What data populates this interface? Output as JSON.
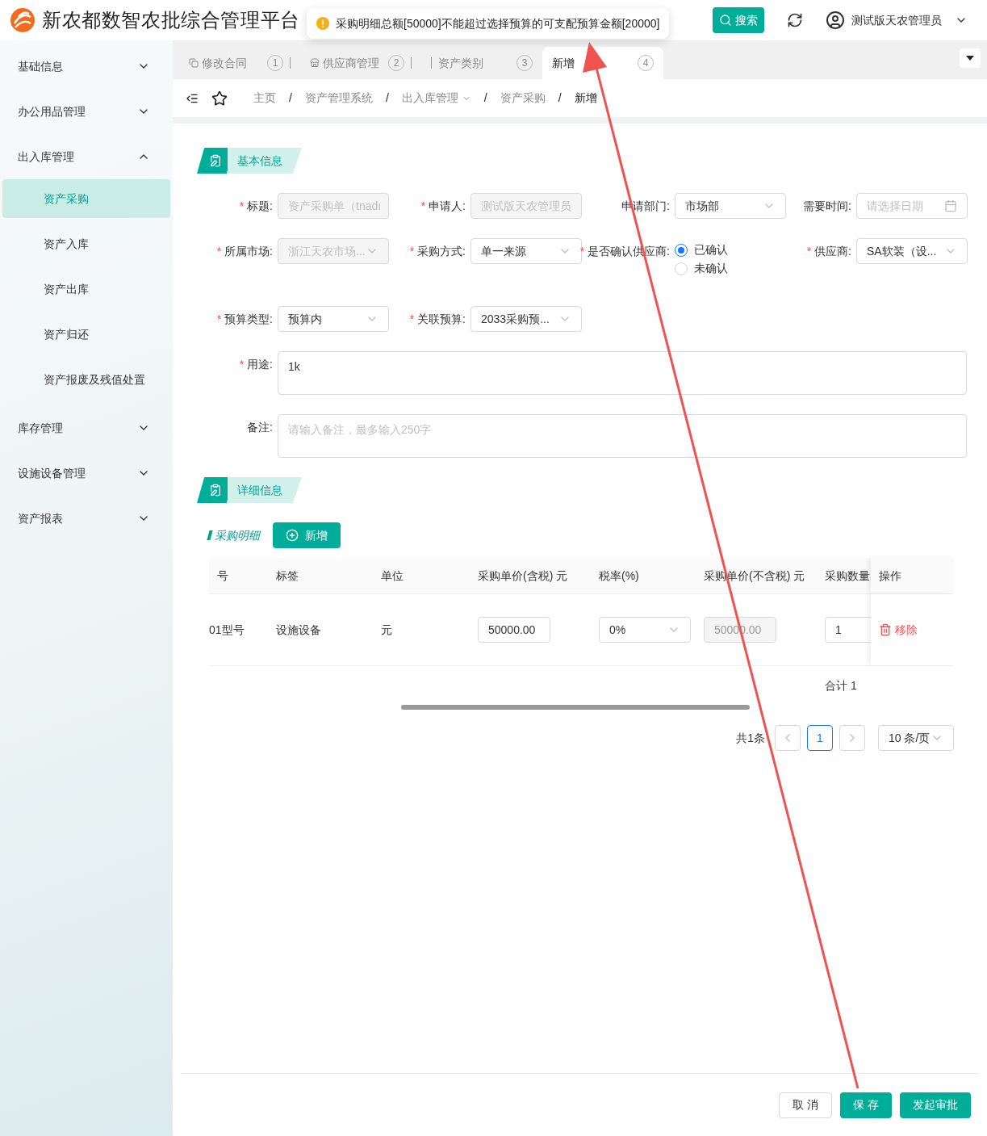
{
  "header": {
    "title": "新农都数智农批综合管理平台",
    "search_button": "搜索",
    "user": "测试版天农管理员"
  },
  "toast": {
    "kind": "warning",
    "message": "采购明细总额[50000]不能超过选择预算的可支配预算金额[20000]"
  },
  "sidebar": {
    "items": [
      {
        "label": "基础信息",
        "expanded": false
      },
      {
        "label": "办公用品管理",
        "expanded": false
      },
      {
        "label": "出入库管理",
        "expanded": true,
        "children": [
          {
            "label": "资产采购",
            "selected": true
          },
          {
            "label": "资产入库",
            "selected": false
          },
          {
            "label": "资产出库",
            "selected": false
          },
          {
            "label": "资产归还",
            "selected": false
          },
          {
            "label": "资产报废及残值处置",
            "selected": false
          }
        ]
      },
      {
        "label": "库存管理",
        "expanded": false
      },
      {
        "label": "设施设备管理",
        "expanded": false
      },
      {
        "label": "资产报表",
        "expanded": false
      }
    ]
  },
  "tabs": [
    {
      "label": "修改合同",
      "badge": "1",
      "selected": false
    },
    {
      "label": "供应商管理",
      "badge": "2",
      "selected": false
    },
    {
      "label": "资产类别",
      "badge": "3",
      "selected": false
    },
    {
      "label": "新增",
      "badge": "4",
      "selected": true
    }
  ],
  "breadcrumb_separator": "/",
  "breadcrumb": [
    {
      "label": "主页",
      "dropdown": false
    },
    {
      "label": "资产管理系统",
      "dropdown": false
    },
    {
      "label": "出入库管理",
      "dropdown": true
    },
    {
      "label": "资产采购",
      "dropdown": false
    },
    {
      "label": "新增",
      "dropdown": false
    }
  ],
  "basic_section": {
    "title": "基本信息",
    "required_mark": "*",
    "fields": [
      {
        "kind": "input",
        "label": "标题:",
        "required": true,
        "disabled": true,
        "value": "资产采购单（tnadı"
      },
      {
        "kind": "input",
        "label": "申请人:",
        "required": true,
        "disabled": true,
        "value": "测试版天农管理员"
      },
      {
        "kind": "select",
        "label": "申请部门:",
        "required": false,
        "disabled": false,
        "value": "市场部"
      },
      {
        "kind": "date",
        "label": "需要时间:",
        "required": false,
        "placeholder": "请选择日期"
      },
      {
        "kind": "select",
        "label": "所属市场:",
        "required": true,
        "disabled": true,
        "value": "浙江天农市场..."
      },
      {
        "kind": "select",
        "label": "采购方式:",
        "required": true,
        "disabled": false,
        "value": "单一来源"
      },
      {
        "kind": "radio",
        "label": "是否确认供应商:",
        "required": true,
        "options": [
          {
            "label": "已确认",
            "selected": true
          },
          {
            "label": "未确认",
            "selected": false
          }
        ]
      },
      {
        "kind": "select",
        "label": "供应商:",
        "required": true,
        "disabled": false,
        "value": "SA软装（设..."
      },
      {
        "kind": "select",
        "label": "预算类型:",
        "required": true,
        "disabled": false,
        "value": "预算内"
      },
      {
        "kind": "select",
        "label": "关联预算:",
        "required": true,
        "disabled": false,
        "value": "2033采购预..."
      },
      {
        "kind": "textarea",
        "label": "用途:",
        "required": true,
        "value": "1k"
      },
      {
        "kind": "textarea",
        "label": "备注:",
        "required": false,
        "placeholder": "请输入备注，最多输入250字"
      }
    ]
  },
  "detail_section": {
    "title": "详细信息",
    "subtitle": "采购明细",
    "add_button": "新增",
    "table": {
      "columns": [
        "号",
        "标签",
        "单位",
        "采购单价(含税) 元",
        "税率(%)",
        "采购单价(不含税) 元",
        "采购数量",
        "操作"
      ],
      "rows": [
        {
          "model": "01型号",
          "tag": "设施设备",
          "unit": "元",
          "price": "50000.00",
          "tax": "0%",
          "net_price": "50000.00",
          "quantity": "1",
          "action": "移除"
        }
      ],
      "summary": "合计 1"
    },
    "pagination": {
      "total": "共1条",
      "pages": [
        {
          "label": "1",
          "selected": true
        }
      ],
      "page_size": "10 条/页"
    }
  },
  "footer": {
    "buttons": [
      {
        "label": "取 消",
        "kind": "default"
      },
      {
        "label": "保 存",
        "kind": "primary"
      },
      {
        "label": "发起审批",
        "kind": "primary"
      }
    ]
  }
}
